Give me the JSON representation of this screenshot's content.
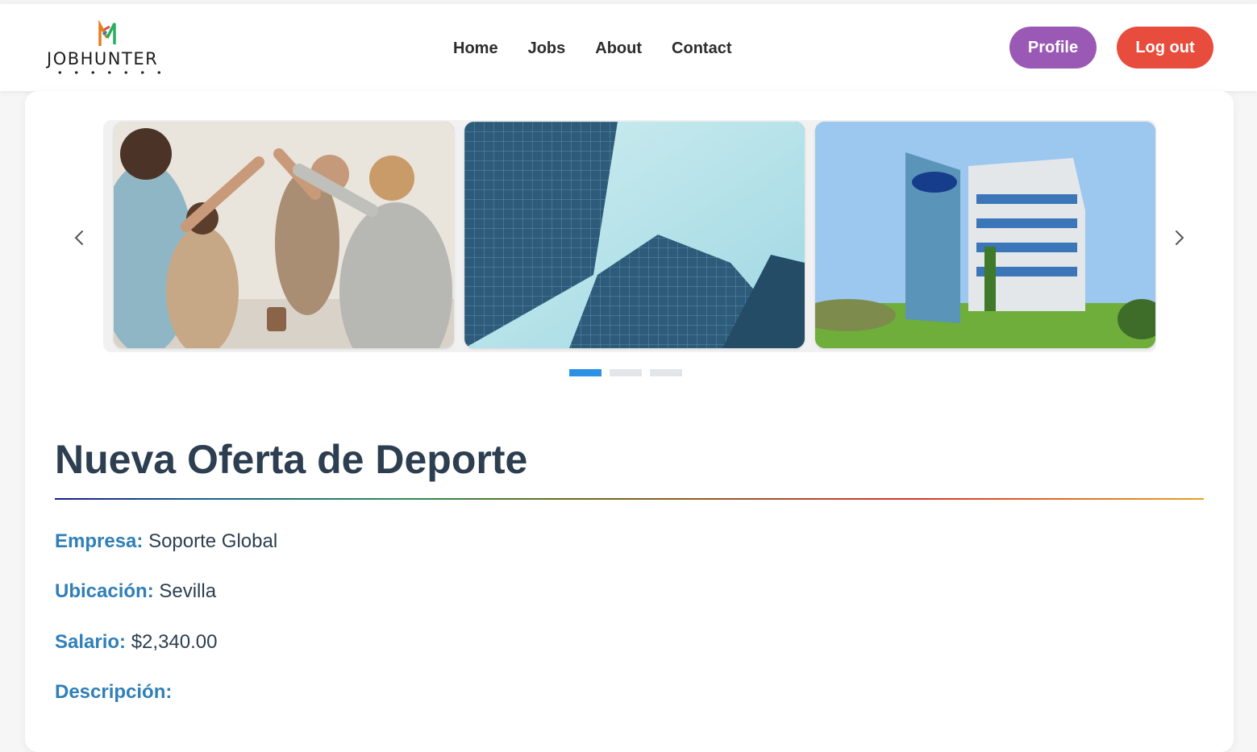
{
  "app": {
    "brand": "JOBHUNTER"
  },
  "nav": {
    "items": [
      "Home",
      "Jobs",
      "About",
      "Contact"
    ]
  },
  "actions": {
    "profile_label": "Profile",
    "logout_label": "Log out",
    "profile_color": "#9b59b6",
    "logout_color": "#e74c3c"
  },
  "carousel": {
    "slides": [
      {
        "icon": "team-high-five-photo"
      },
      {
        "icon": "glass-skyscrapers-photo"
      },
      {
        "icon": "ford-office-building-photo"
      }
    ],
    "active_index": 0,
    "dot_count": 3,
    "accent": "#2b91e6"
  },
  "offer": {
    "title": "Nueva Oferta de Deporte",
    "company_label": "Empresa:",
    "company_value": "Soporte Global",
    "location_label": "Ubicación:",
    "location_value": "Sevilla",
    "salary_label": "Salario:",
    "salary_value": "$2,340.00",
    "description_label": "Descripción:",
    "label_color": "#2f7fb8"
  }
}
